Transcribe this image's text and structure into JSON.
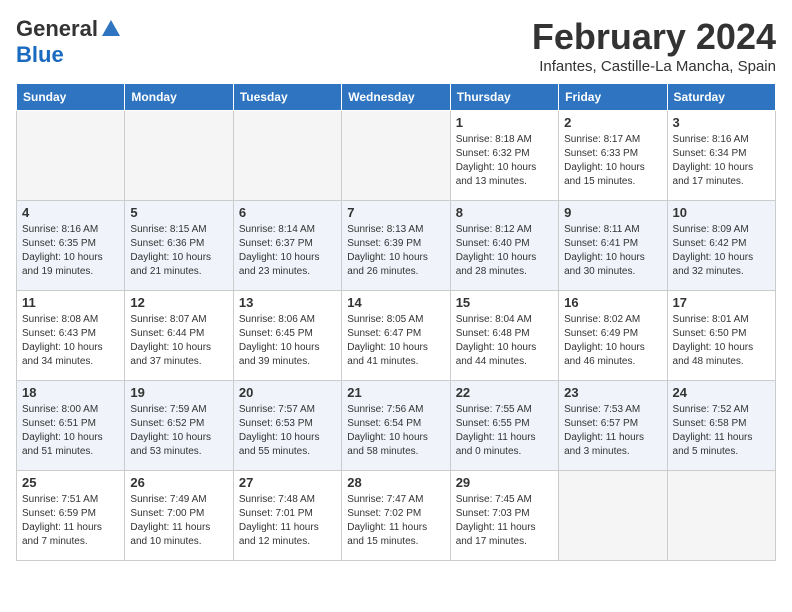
{
  "header": {
    "logo_general": "General",
    "logo_blue": "Blue",
    "month_year": "February 2024",
    "location": "Infantes, Castille-La Mancha, Spain"
  },
  "weekdays": [
    "Sunday",
    "Monday",
    "Tuesday",
    "Wednesday",
    "Thursday",
    "Friday",
    "Saturday"
  ],
  "weeks": [
    [
      {
        "num": "",
        "info": ""
      },
      {
        "num": "",
        "info": ""
      },
      {
        "num": "",
        "info": ""
      },
      {
        "num": "",
        "info": ""
      },
      {
        "num": "1",
        "info": "Sunrise: 8:18 AM\nSunset: 6:32 PM\nDaylight: 10 hours\nand 13 minutes."
      },
      {
        "num": "2",
        "info": "Sunrise: 8:17 AM\nSunset: 6:33 PM\nDaylight: 10 hours\nand 15 minutes."
      },
      {
        "num": "3",
        "info": "Sunrise: 8:16 AM\nSunset: 6:34 PM\nDaylight: 10 hours\nand 17 minutes."
      }
    ],
    [
      {
        "num": "4",
        "info": "Sunrise: 8:16 AM\nSunset: 6:35 PM\nDaylight: 10 hours\nand 19 minutes."
      },
      {
        "num": "5",
        "info": "Sunrise: 8:15 AM\nSunset: 6:36 PM\nDaylight: 10 hours\nand 21 minutes."
      },
      {
        "num": "6",
        "info": "Sunrise: 8:14 AM\nSunset: 6:37 PM\nDaylight: 10 hours\nand 23 minutes."
      },
      {
        "num": "7",
        "info": "Sunrise: 8:13 AM\nSunset: 6:39 PM\nDaylight: 10 hours\nand 26 minutes."
      },
      {
        "num": "8",
        "info": "Sunrise: 8:12 AM\nSunset: 6:40 PM\nDaylight: 10 hours\nand 28 minutes."
      },
      {
        "num": "9",
        "info": "Sunrise: 8:11 AM\nSunset: 6:41 PM\nDaylight: 10 hours\nand 30 minutes."
      },
      {
        "num": "10",
        "info": "Sunrise: 8:09 AM\nSunset: 6:42 PM\nDaylight: 10 hours\nand 32 minutes."
      }
    ],
    [
      {
        "num": "11",
        "info": "Sunrise: 8:08 AM\nSunset: 6:43 PM\nDaylight: 10 hours\nand 34 minutes."
      },
      {
        "num": "12",
        "info": "Sunrise: 8:07 AM\nSunset: 6:44 PM\nDaylight: 10 hours\nand 37 minutes."
      },
      {
        "num": "13",
        "info": "Sunrise: 8:06 AM\nSunset: 6:45 PM\nDaylight: 10 hours\nand 39 minutes."
      },
      {
        "num": "14",
        "info": "Sunrise: 8:05 AM\nSunset: 6:47 PM\nDaylight: 10 hours\nand 41 minutes."
      },
      {
        "num": "15",
        "info": "Sunrise: 8:04 AM\nSunset: 6:48 PM\nDaylight: 10 hours\nand 44 minutes."
      },
      {
        "num": "16",
        "info": "Sunrise: 8:02 AM\nSunset: 6:49 PM\nDaylight: 10 hours\nand 46 minutes."
      },
      {
        "num": "17",
        "info": "Sunrise: 8:01 AM\nSunset: 6:50 PM\nDaylight: 10 hours\nand 48 minutes."
      }
    ],
    [
      {
        "num": "18",
        "info": "Sunrise: 8:00 AM\nSunset: 6:51 PM\nDaylight: 10 hours\nand 51 minutes."
      },
      {
        "num": "19",
        "info": "Sunrise: 7:59 AM\nSunset: 6:52 PM\nDaylight: 10 hours\nand 53 minutes."
      },
      {
        "num": "20",
        "info": "Sunrise: 7:57 AM\nSunset: 6:53 PM\nDaylight: 10 hours\nand 55 minutes."
      },
      {
        "num": "21",
        "info": "Sunrise: 7:56 AM\nSunset: 6:54 PM\nDaylight: 10 hours\nand 58 minutes."
      },
      {
        "num": "22",
        "info": "Sunrise: 7:55 AM\nSunset: 6:55 PM\nDaylight: 11 hours\nand 0 minutes."
      },
      {
        "num": "23",
        "info": "Sunrise: 7:53 AM\nSunset: 6:57 PM\nDaylight: 11 hours\nand 3 minutes."
      },
      {
        "num": "24",
        "info": "Sunrise: 7:52 AM\nSunset: 6:58 PM\nDaylight: 11 hours\nand 5 minutes."
      }
    ],
    [
      {
        "num": "25",
        "info": "Sunrise: 7:51 AM\nSunset: 6:59 PM\nDaylight: 11 hours\nand 7 minutes."
      },
      {
        "num": "26",
        "info": "Sunrise: 7:49 AM\nSunset: 7:00 PM\nDaylight: 11 hours\nand 10 minutes."
      },
      {
        "num": "27",
        "info": "Sunrise: 7:48 AM\nSunset: 7:01 PM\nDaylight: 11 hours\nand 12 minutes."
      },
      {
        "num": "28",
        "info": "Sunrise: 7:47 AM\nSunset: 7:02 PM\nDaylight: 11 hours\nand 15 minutes."
      },
      {
        "num": "29",
        "info": "Sunrise: 7:45 AM\nSunset: 7:03 PM\nDaylight: 11 hours\nand 17 minutes."
      },
      {
        "num": "",
        "info": ""
      },
      {
        "num": "",
        "info": ""
      }
    ]
  ]
}
